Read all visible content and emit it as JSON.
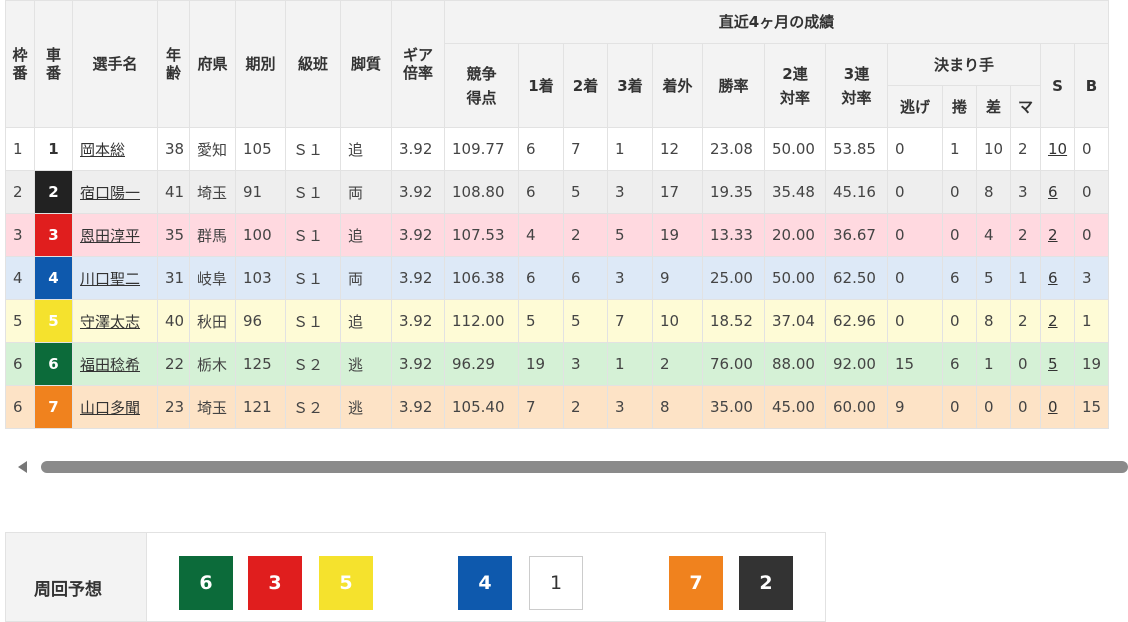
{
  "colors": {
    "car_bg": [
      "#ffffff",
      "#222222",
      "#e01e1e",
      "#0e59ad",
      "#f5e22d",
      "#0c6b3a",
      "#f0821e"
    ],
    "car_fg": [
      "#333333",
      "#ffffff",
      "#ffffff",
      "#ffffff",
      "#ffffff",
      "#ffffff",
      "#ffffff"
    ],
    "row_bg": [
      "#ffffff",
      "#eeeeee",
      "#ffd9e0",
      "#dde9f7",
      "#fefbd6",
      "#d5f1d6",
      "#fde3c6"
    ]
  },
  "header": {
    "waku": "枠番",
    "sha": "車番",
    "name": "選手名",
    "age": "年齢",
    "pref": "府県",
    "term": "期別",
    "class": "級班",
    "style": "脚質",
    "gear": "ギア倍率",
    "recent": "直近4ヶ月の成績",
    "score": "競争得点",
    "first": "1着",
    "second": "2着",
    "third": "3着",
    "out": "着外",
    "win_rate": "勝率",
    "ren2": "2連対率",
    "ren3": "3連対率",
    "kimarite": "決まり手",
    "nige": "逃げ",
    "makuri": "捲",
    "sashi": "差",
    "mark": "マ",
    "s": "S",
    "b": "B"
  },
  "riders": [
    {
      "waku": "1",
      "car": "1",
      "name": "岡本総",
      "age": "38",
      "pref": "愛知",
      "term": "105",
      "class": "Ｓ１",
      "style": "追",
      "gear": "3.92",
      "score": "109.77",
      "first": "6",
      "second": "7",
      "third": "1",
      "out": "12",
      "win": "23.08",
      "ren2": "50.00",
      "ren3": "53.85",
      "nige": "0",
      "makuri": "1",
      "sashi": "10",
      "mark": "2",
      "s": "10",
      "b": "0"
    },
    {
      "waku": "2",
      "car": "2",
      "name": "宿口陽一",
      "age": "41",
      "pref": "埼玉",
      "term": "91",
      "class": "Ｓ１",
      "style": "両",
      "gear": "3.92",
      "score": "108.80",
      "first": "6",
      "second": "5",
      "third": "3",
      "out": "17",
      "win": "19.35",
      "ren2": "35.48",
      "ren3": "45.16",
      "nige": "0",
      "makuri": "0",
      "sashi": "8",
      "mark": "3",
      "s": "6",
      "b": "0"
    },
    {
      "waku": "3",
      "car": "3",
      "name": "恩田淳平",
      "age": "35",
      "pref": "群馬",
      "term": "100",
      "class": "Ｓ１",
      "style": "追",
      "gear": "3.92",
      "score": "107.53",
      "first": "4",
      "second": "2",
      "third": "5",
      "out": "19",
      "win": "13.33",
      "ren2": "20.00",
      "ren3": "36.67",
      "nige": "0",
      "makuri": "0",
      "sashi": "4",
      "mark": "2",
      "s": "2",
      "b": "0"
    },
    {
      "waku": "4",
      "car": "4",
      "name": "川口聖二",
      "age": "31",
      "pref": "岐阜",
      "term": "103",
      "class": "Ｓ１",
      "style": "両",
      "gear": "3.92",
      "score": "106.38",
      "first": "6",
      "second": "6",
      "third": "3",
      "out": "9",
      "win": "25.00",
      "ren2": "50.00",
      "ren3": "62.50",
      "nige": "0",
      "makuri": "6",
      "sashi": "5",
      "mark": "1",
      "s": "6",
      "b": "3"
    },
    {
      "waku": "5",
      "car": "5",
      "name": "守澤太志",
      "age": "40",
      "pref": "秋田",
      "term": "96",
      "class": "Ｓ１",
      "style": "追",
      "gear": "3.92",
      "score": "112.00",
      "first": "5",
      "second": "5",
      "third": "7",
      "out": "10",
      "win": "18.52",
      "ren2": "37.04",
      "ren3": "62.96",
      "nige": "0",
      "makuri": "0",
      "sashi": "8",
      "mark": "2",
      "s": "2",
      "b": "1"
    },
    {
      "waku": "6",
      "car": "6",
      "name": "福田稔希",
      "age": "22",
      "pref": "栃木",
      "term": "125",
      "class": "Ｓ２",
      "style": "逃",
      "gear": "3.92",
      "score": "96.29",
      "first": "19",
      "second": "3",
      "third": "1",
      "out": "2",
      "win": "76.00",
      "ren2": "88.00",
      "ren3": "92.00",
      "nige": "15",
      "makuri": "6",
      "sashi": "1",
      "mark": "0",
      "s": "5",
      "b": "19"
    },
    {
      "waku": "6",
      "car": "7",
      "name": "山口多聞",
      "age": "23",
      "pref": "埼玉",
      "term": "121",
      "class": "Ｓ２",
      "style": "逃",
      "gear": "3.92",
      "score": "105.40",
      "first": "7",
      "second": "2",
      "third": "3",
      "out": "8",
      "win": "35.00",
      "ren2": "45.00",
      "ren3": "60.00",
      "nige": "9",
      "makuri": "0",
      "sashi": "0",
      "mark": "0",
      "s": "0",
      "b": "15"
    }
  ],
  "prediction": {
    "label": "周回予想",
    "chips": [
      {
        "car": "6",
        "bg": "#0c6b3a",
        "fg": "#ffffff",
        "border": "#0c6b3a"
      },
      {
        "car": "3",
        "bg": "#e01e1e",
        "fg": "#ffffff",
        "border": "#e01e1e"
      },
      {
        "car": "5",
        "bg": "#f5e22d",
        "fg": "#ffffff",
        "border": "#f5e22d"
      },
      {
        "car": "4",
        "bg": "#0e59ad",
        "fg": "#ffffff",
        "border": "#0e59ad"
      },
      {
        "car": "1",
        "bg": "#ffffff",
        "fg": "#333333",
        "border": "#cccccc"
      },
      {
        "car": "7",
        "bg": "#f0821e",
        "fg": "#ffffff",
        "border": "#f0821e"
      },
      {
        "car": "2",
        "bg": "#333333",
        "fg": "#ffffff",
        "border": "#333333"
      }
    ]
  }
}
